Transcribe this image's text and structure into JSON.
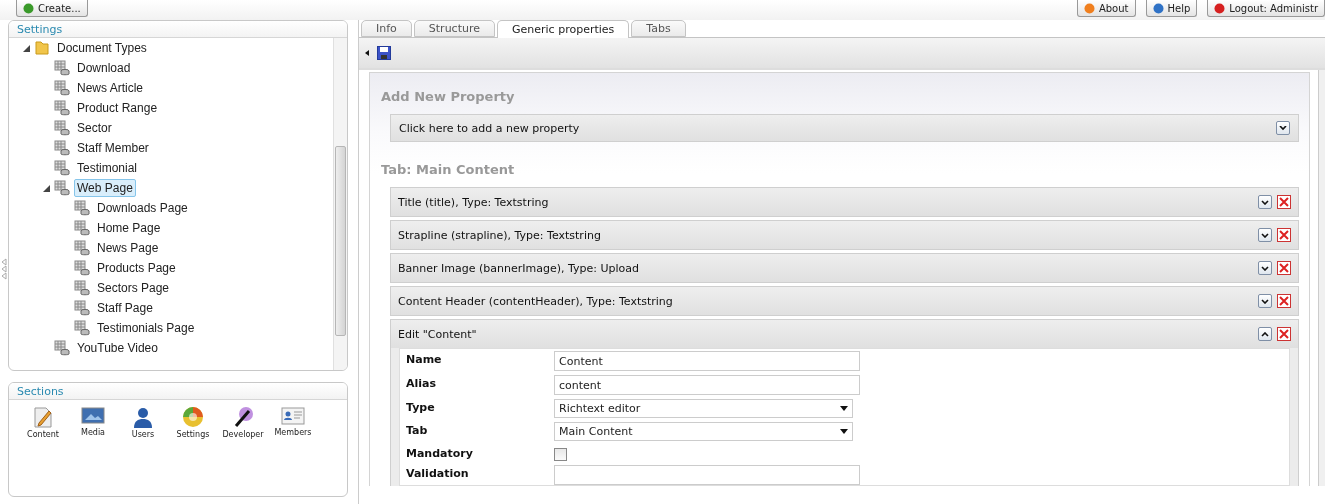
{
  "top_bar": {
    "left_buttons": [
      {
        "label": "Create...",
        "kind": "create"
      }
    ],
    "right_buttons": [
      {
        "label": "About",
        "kind": "about"
      },
      {
        "label": "Help",
        "kind": "help"
      },
      {
        "label": "Logout: Administr",
        "kind": "logout"
      }
    ]
  },
  "settings_panel": {
    "title": "Settings",
    "tree": [
      {
        "label": "Document Types",
        "kind": "folder",
        "expanded": true,
        "selected": false,
        "children": [
          {
            "label": "Download",
            "kind": "doctype",
            "selected": false
          },
          {
            "label": "News Article",
            "kind": "doctype",
            "selected": false
          },
          {
            "label": "Product Range",
            "kind": "doctype",
            "selected": false
          },
          {
            "label": "Sector",
            "kind": "doctype",
            "selected": false
          },
          {
            "label": "Staff Member",
            "kind": "doctype",
            "selected": false
          },
          {
            "label": "Testimonial",
            "kind": "doctype",
            "selected": false
          },
          {
            "label": "Web Page",
            "kind": "doctype",
            "expanded": true,
            "selected": true,
            "children": [
              {
                "label": "Downloads Page",
                "kind": "doctype",
                "selected": false
              },
              {
                "label": "Home Page",
                "kind": "doctype",
                "selected": false
              },
              {
                "label": "News Page",
                "kind": "doctype",
                "selected": false
              },
              {
                "label": "Products Page",
                "kind": "doctype",
                "selected": false
              },
              {
                "label": "Sectors Page",
                "kind": "doctype",
                "selected": false
              },
              {
                "label": "Staff Page",
                "kind": "doctype",
                "selected": false
              },
              {
                "label": "Testimonials Page",
                "kind": "doctype",
                "selected": false
              }
            ]
          },
          {
            "label": "YouTube Video",
            "kind": "doctype",
            "selected": false
          }
        ]
      }
    ]
  },
  "sections_panel": {
    "title": "Sections",
    "items": [
      {
        "label": "Content",
        "kind": "content"
      },
      {
        "label": "Media",
        "kind": "media"
      },
      {
        "label": "Users",
        "kind": "users"
      },
      {
        "label": "Settings",
        "kind": "settings"
      },
      {
        "label": "Developer",
        "kind": "developer"
      },
      {
        "label": "Members",
        "kind": "members"
      }
    ]
  },
  "tabs": [
    {
      "label": "Info",
      "selected": false
    },
    {
      "label": "Structure",
      "selected": false
    },
    {
      "label": "Generic properties",
      "selected": true
    },
    {
      "label": "Tabs",
      "selected": false
    }
  ],
  "add_property": {
    "heading": "Add New Property",
    "bar": "Click here to add a new property"
  },
  "tab_heading": "Tab: Main Content",
  "properties": [
    {
      "label": "Title (title), Type: Textstring",
      "expanded": false
    },
    {
      "label": "Strapline (strapline), Type: Textstring",
      "expanded": false
    },
    {
      "label": "Banner Image (bannerImage), Type: Upload",
      "expanded": false
    },
    {
      "label": "Content Header (contentHeader), Type: Textstring",
      "expanded": false
    },
    {
      "label": "Edit \"Content\"",
      "expanded": true,
      "fields": [
        {
          "label": "Name",
          "kind": "text",
          "value": "Content"
        },
        {
          "label": "Alias",
          "kind": "text",
          "value": "content"
        },
        {
          "label": "Type",
          "kind": "select",
          "value": "Richtext editor"
        },
        {
          "label": "Tab",
          "kind": "select",
          "value": "Main Content"
        },
        {
          "label": "Mandatory",
          "kind": "checkbox",
          "checked": false
        },
        {
          "label": "Validation",
          "kind": "text"
        }
      ]
    }
  ]
}
